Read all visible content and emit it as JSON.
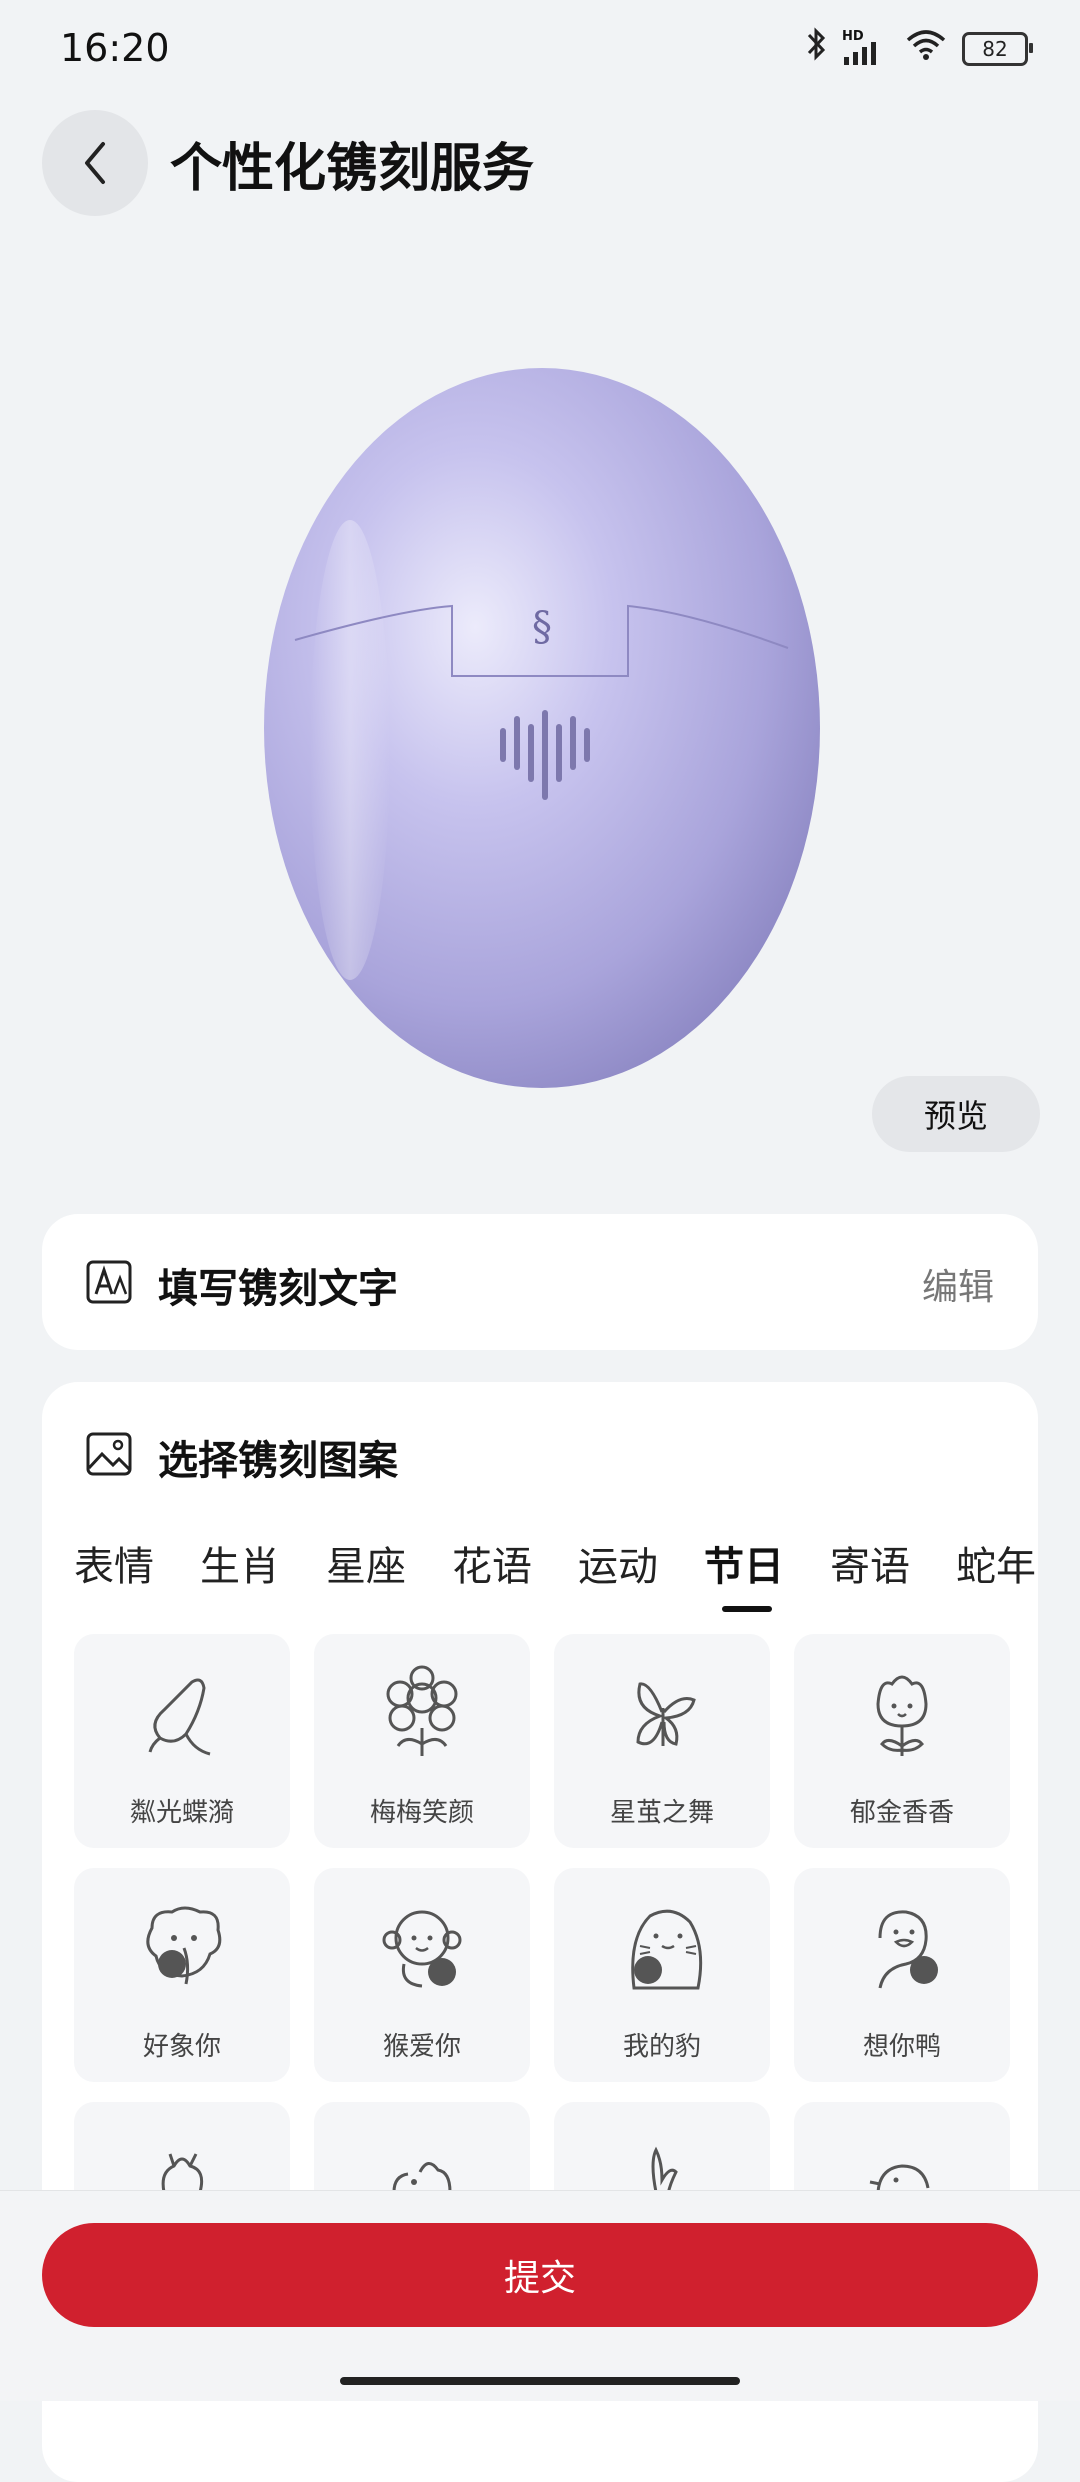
{
  "status_bar": {
    "time": "16:20",
    "battery": "82",
    "network_label": "HD"
  },
  "header": {
    "title": "个性化镌刻服务"
  },
  "product": {
    "color": "#b8b4e6"
  },
  "preview_label": "预览",
  "text_card": {
    "title": "填写镌刻文字",
    "edit_label": "编辑"
  },
  "pattern_card": {
    "title": "选择镌刻图案",
    "tabs": [
      "表情",
      "生肖",
      "星座",
      "花语",
      "运动",
      "节日",
      "寄语",
      "蛇年"
    ],
    "active_tab": "节日",
    "patterns": [
      {
        "label": "粼光蝶漪",
        "icon": "butterfly-icon"
      },
      {
        "label": "梅梅笑颜",
        "icon": "flower-icon"
      },
      {
        "label": "星茧之舞",
        "icon": "butterfly-icon"
      },
      {
        "label": "郁金香香",
        "icon": "tulip-icon"
      },
      {
        "label": "好象你",
        "icon": "elephant-icon"
      },
      {
        "label": "猴爱你",
        "icon": "monkey-icon"
      },
      {
        "label": "我的豹",
        "icon": "seal-icon"
      },
      {
        "label": "想你鸭",
        "icon": "duck-icon"
      },
      {
        "label": "",
        "icon": "pattern-icon"
      },
      {
        "label": "",
        "icon": "pattern-icon"
      },
      {
        "label": "",
        "icon": "rabbit-icon"
      },
      {
        "label": "",
        "icon": "bird-icon"
      }
    ]
  },
  "submit_label": "提交",
  "colors": {
    "accent": "#d0202e",
    "background": "#f1f3f5"
  }
}
